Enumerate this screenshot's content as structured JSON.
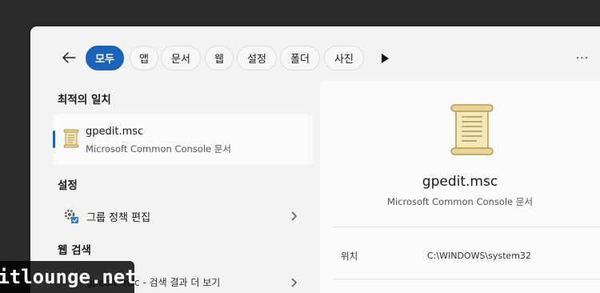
{
  "filters": {
    "active": "모두",
    "items": [
      "모두",
      "앱",
      "문서",
      "웹",
      "설정",
      "폴더",
      "사진"
    ]
  },
  "sections": {
    "best_match": "최적의 일치",
    "settings": "설정",
    "web_search": "웹 검색"
  },
  "best_match": {
    "name": "gpedit.msc",
    "type": "Microsoft Common Console 문서"
  },
  "settings_item": {
    "label": "그룹 정책 편집"
  },
  "web_item": {
    "label": "gpedit.msc - 검색 결과 더 보기"
  },
  "details": {
    "title": "gpedit.msc",
    "subtitle": "Microsoft Common Console 문서",
    "location_label": "위치",
    "location_value": "C:\\WINDOWS\\system32"
  },
  "watermark": "itlounge.net",
  "colors": {
    "accent": "#1a63b8",
    "background": "#2b2b2b",
    "panel": "#f3f3f3"
  }
}
